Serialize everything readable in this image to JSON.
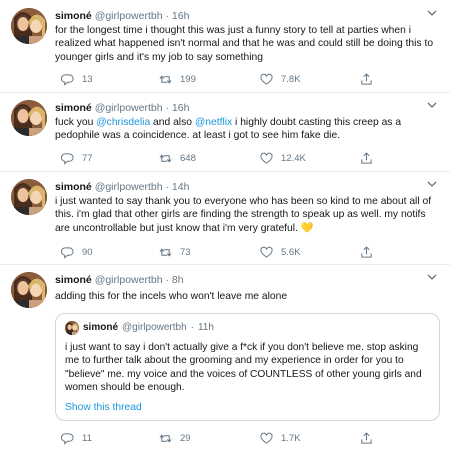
{
  "colors": {
    "accent": "#1b95e0",
    "meta": "#657786",
    "heart_emoji": "#f5c22f",
    "border": "#e6ecf0"
  },
  "icons": {
    "reply": "reply-icon",
    "retweet": "retweet-icon",
    "like": "like-icon",
    "share": "share-icon",
    "more": "chevron-down-icon"
  },
  "tweets": [
    {
      "display_name": "simoné",
      "handle": "@girlpowertbh",
      "sep": "·",
      "time": "16h",
      "text": "for the longest time i thought this was just a funny story to tell at parties when i realized what happened isn't normal and that he was and could still be doing this to younger girls and it's my job to say something",
      "replies": "13",
      "retweets": "199",
      "likes": "7.8K"
    },
    {
      "display_name": "simoné",
      "handle": "@girlpowertbh",
      "sep": "·",
      "time": "16h",
      "text_a": "fuck you ",
      "mention1": "@chrisdelia",
      "text_b": " and also ",
      "mention2": "@netflix",
      "text_c": " i highly doubt casting this creep as a pedophile was a coincidence. at least i got to see him fake die.",
      "replies": "77",
      "retweets": "648",
      "likes": "12.4K"
    },
    {
      "display_name": "simoné",
      "handle": "@girlpowertbh",
      "sep": "·",
      "time": "14h",
      "text": "i just wanted to say thank you to everyone who has been so kind to me about all of this. i'm glad that other girls are finding the strength to speak up as well. my notifs are uncontrollable but just know that i'm very grateful.",
      "emoji": "💛",
      "replies": "90",
      "retweets": "73",
      "likes": "5.6K"
    },
    {
      "display_name": "simoné",
      "handle": "@girlpowertbh",
      "sep": "·",
      "time": "8h",
      "text": "adding this for the incels who won't leave me alone",
      "quote": {
        "display_name": "simoné",
        "handle": "@girlpowertbh",
        "sep": "·",
        "time": "11h",
        "text": "i just want to say i don't actually give a f*ck if you don't believe me. stop asking me to further talk about the grooming and my experience in order for you to \"believe\" me. my voice and the voices of COUNTLESS of other young girls and women should be enough.",
        "show_thread": "Show this thread"
      },
      "replies": "11",
      "retweets": "29",
      "likes": "1.7K"
    }
  ]
}
